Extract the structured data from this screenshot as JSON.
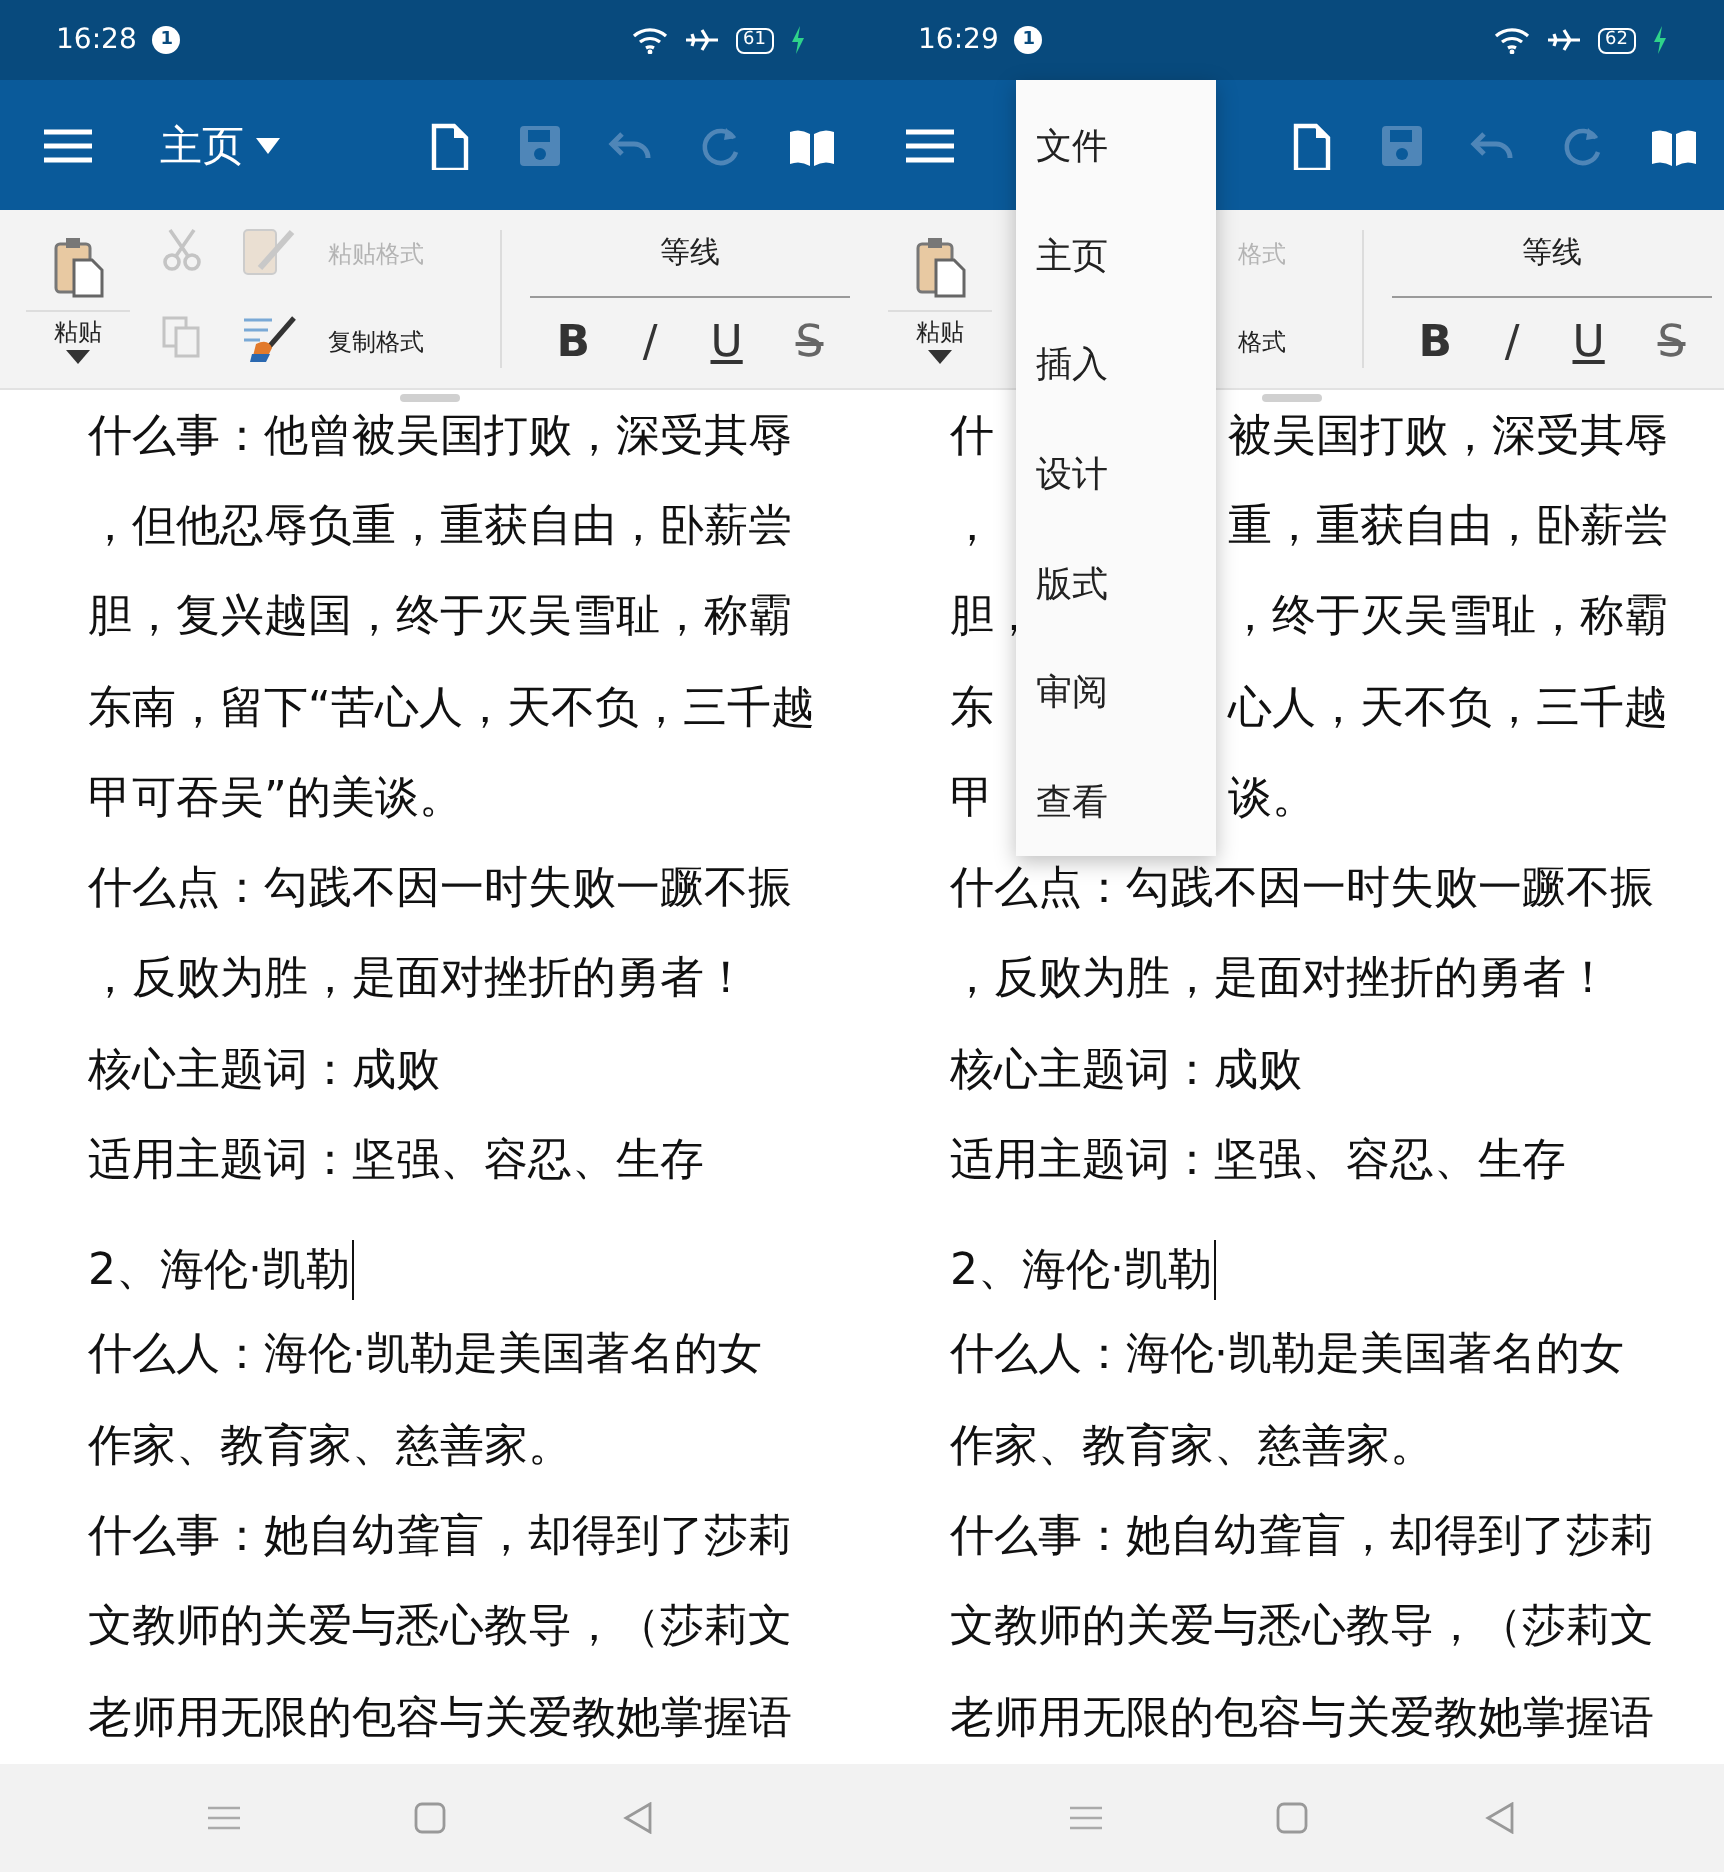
{
  "phones": [
    {
      "status": {
        "time": "16:28",
        "badge": "1",
        "battery": "61"
      },
      "toolbar": {
        "title": "主页",
        "actions": [
          {
            "kind": "new",
            "disabled": false
          },
          {
            "kind": "save",
            "disabled": true
          },
          {
            "kind": "undo",
            "disabled": true
          },
          {
            "kind": "redo",
            "disabled": true
          },
          {
            "kind": "read",
            "disabled": false
          }
        ]
      },
      "ribbon": {
        "paste": "粘贴",
        "tools": [
          {
            "kind": "cut",
            "disabled": true
          },
          {
            "kind": "copy",
            "disabled": true
          }
        ],
        "paste_format": {
          "label": "粘贴格式",
          "disabled": true
        },
        "copy_format": {
          "label": "复制格式",
          "disabled": false
        },
        "font": "等线",
        "styles": [
          {
            "kind": "bold",
            "text": "B"
          },
          {
            "kind": "italic",
            "text": "/"
          },
          {
            "kind": "underline",
            "text": "U"
          },
          {
            "kind": "strike",
            "text": "S"
          }
        ]
      },
      "lines": [
        {
          "kind": "text",
          "text": "什么事：他曾被吴国打败，深受其辱"
        },
        {
          "kind": "text",
          "text": "，但他忍辱负重，重获自由，卧薪尝"
        },
        {
          "kind": "text",
          "text": "胆，复兴越国，终于灭吴雪耻，称霸"
        },
        {
          "kind": "text",
          "text": "东南，留下“苦心人，天不负，三千越"
        },
        {
          "kind": "text",
          "text": "甲可吞吴”的美谈。"
        },
        {
          "kind": "text",
          "text": "什么点：勾践不因一时失败一蹶不振"
        },
        {
          "kind": "text",
          "text": "，反败为胜，是面对挫折的勇者！"
        },
        {
          "kind": "text",
          "text": "核心主题词：成败"
        },
        {
          "kind": "text",
          "text": "适用主题词：坚强、容忍、生存"
        },
        {
          "kind": "heading",
          "text": "2、海伦·凯勒",
          "cursor": true
        },
        {
          "kind": "text",
          "text": "什么人：海伦·凯勒是美国著名的女"
        },
        {
          "kind": "text",
          "text": "作家、教育家、慈善家。"
        },
        {
          "kind": "text",
          "text": "什么事：她自幼聋盲，却得到了莎莉"
        },
        {
          "kind": "text",
          "text": "文教师的关爱与悉心教导，（莎莉文"
        },
        {
          "kind": "text",
          "text": "老师用无限的包容与关爱教她掌握语"
        }
      ]
    },
    {
      "status": {
        "time": "16:29",
        "badge": "1",
        "battery": "62"
      },
      "toolbar": {
        "actions": [
          {
            "kind": "new",
            "disabled": false
          },
          {
            "kind": "save",
            "disabled": true
          },
          {
            "kind": "undo",
            "disabled": true
          },
          {
            "kind": "redo",
            "disabled": true
          },
          {
            "kind": "read",
            "disabled": false
          }
        ]
      },
      "ribbon": {
        "paste": "粘贴",
        "paste_format": {
          "label": "格式",
          "disabled": true
        },
        "copy_format": {
          "label": "格式",
          "disabled": false
        },
        "font": "等线",
        "styles": [
          {
            "kind": "bold",
            "text": "B"
          },
          {
            "kind": "italic",
            "text": "/"
          },
          {
            "kind": "underline",
            "text": "U"
          },
          {
            "kind": "strike",
            "text": "S"
          }
        ]
      },
      "menu": [
        "文件",
        "主页",
        "插入",
        "设计",
        "版式",
        "审阅",
        "查看"
      ],
      "lines": [
        {
          "kind": "split",
          "left": "什",
          "right": "被吴国打败，深受其辱"
        },
        {
          "kind": "split",
          "left": "，",
          "right": "重，重获自由，卧薪尝"
        },
        {
          "kind": "split",
          "left": "胆，",
          "right": "，终于灭吴雪耻，称霸"
        },
        {
          "kind": "split",
          "left": "东",
          "right": "心人，天不负，三千越"
        },
        {
          "kind": "split",
          "left": "甲",
          "right": "谈。"
        },
        {
          "kind": "text",
          "text": "什么点：勾践不因一时失败一蹶不振"
        },
        {
          "kind": "text",
          "text": "，反败为胜，是面对挫折的勇者！"
        },
        {
          "kind": "text",
          "text": "核心主题词：成败"
        },
        {
          "kind": "text",
          "text": "适用主题词：坚强、容忍、生存"
        },
        {
          "kind": "heading",
          "text": "2、海伦·凯勒",
          "cursor": true
        },
        {
          "kind": "text",
          "text": "什么人：海伦·凯勒是美国著名的女"
        },
        {
          "kind": "text",
          "text": "作家、教育家、慈善家。"
        },
        {
          "kind": "text",
          "text": "什么事：她自幼聋盲，却得到了莎莉"
        },
        {
          "kind": "text",
          "text": "文教师的关爱与悉心教导，（莎莉文"
        },
        {
          "kind": "text",
          "text": "老师用无限的包容与关爱教她掌握语"
        }
      ]
    }
  ]
}
